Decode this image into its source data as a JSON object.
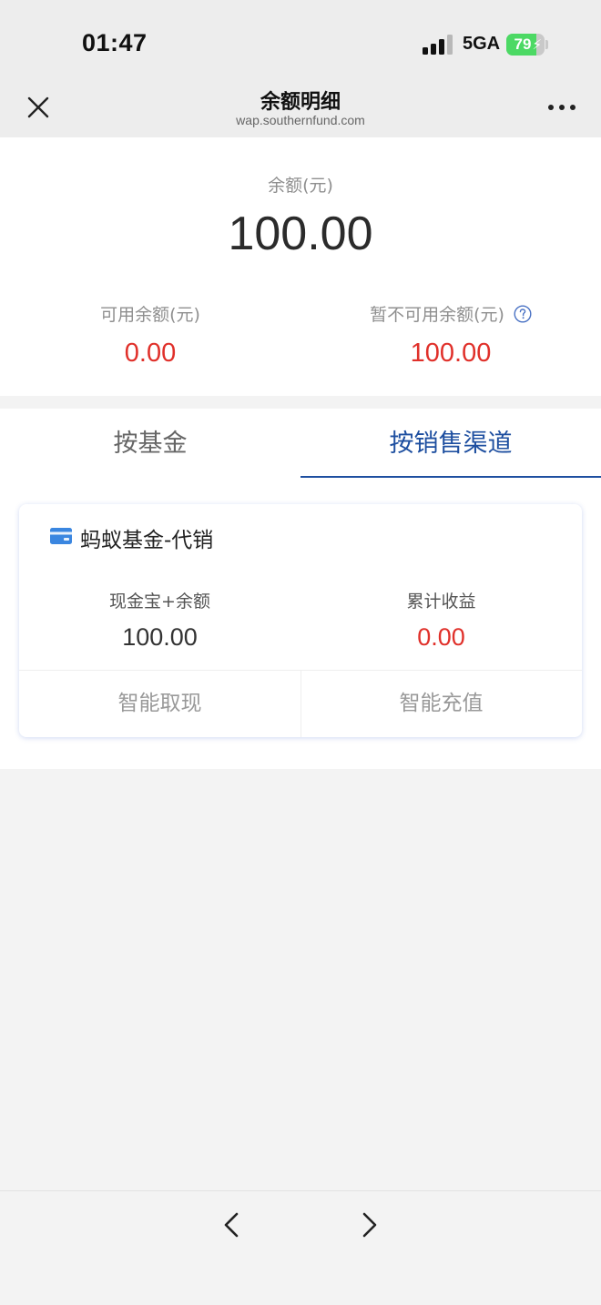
{
  "status_bar": {
    "time": "01:47",
    "network": "5GA",
    "battery": "79",
    "battery_level": 0.79,
    "battery_color": "#4cd964"
  },
  "nav": {
    "title": "余额明细",
    "url": "wap.southernfund.com",
    "close_icon": "close-icon",
    "more_icon": "more-icon"
  },
  "summary": {
    "balance_label": "余额(元)",
    "balance_value": "100.00",
    "available_label": "可用余额(元)",
    "available_value": "0.00",
    "unavailable_label": "暂不可用余额(元)",
    "unavailable_value": "100.00",
    "help_icon": "question-circle-icon"
  },
  "tabs": [
    {
      "label": "按基金",
      "active": false
    },
    {
      "label": "按销售渠道",
      "active": true
    }
  ],
  "card": {
    "icon": "credit-card-icon",
    "title": "蚂蚁基金-代销",
    "left_label": "现金宝+余额",
    "left_value": "100.00",
    "right_label": "累计收益",
    "right_value": "0.00",
    "action_left": "智能取现",
    "action_right": "智能充值"
  },
  "bottom_nav": {
    "back_icon": "chevron-left-icon",
    "forward_icon": "chevron-right-icon"
  },
  "colors": {
    "accent": "#1e4fa0",
    "negative": "#e0302a",
    "background": "#f3f3f3"
  }
}
